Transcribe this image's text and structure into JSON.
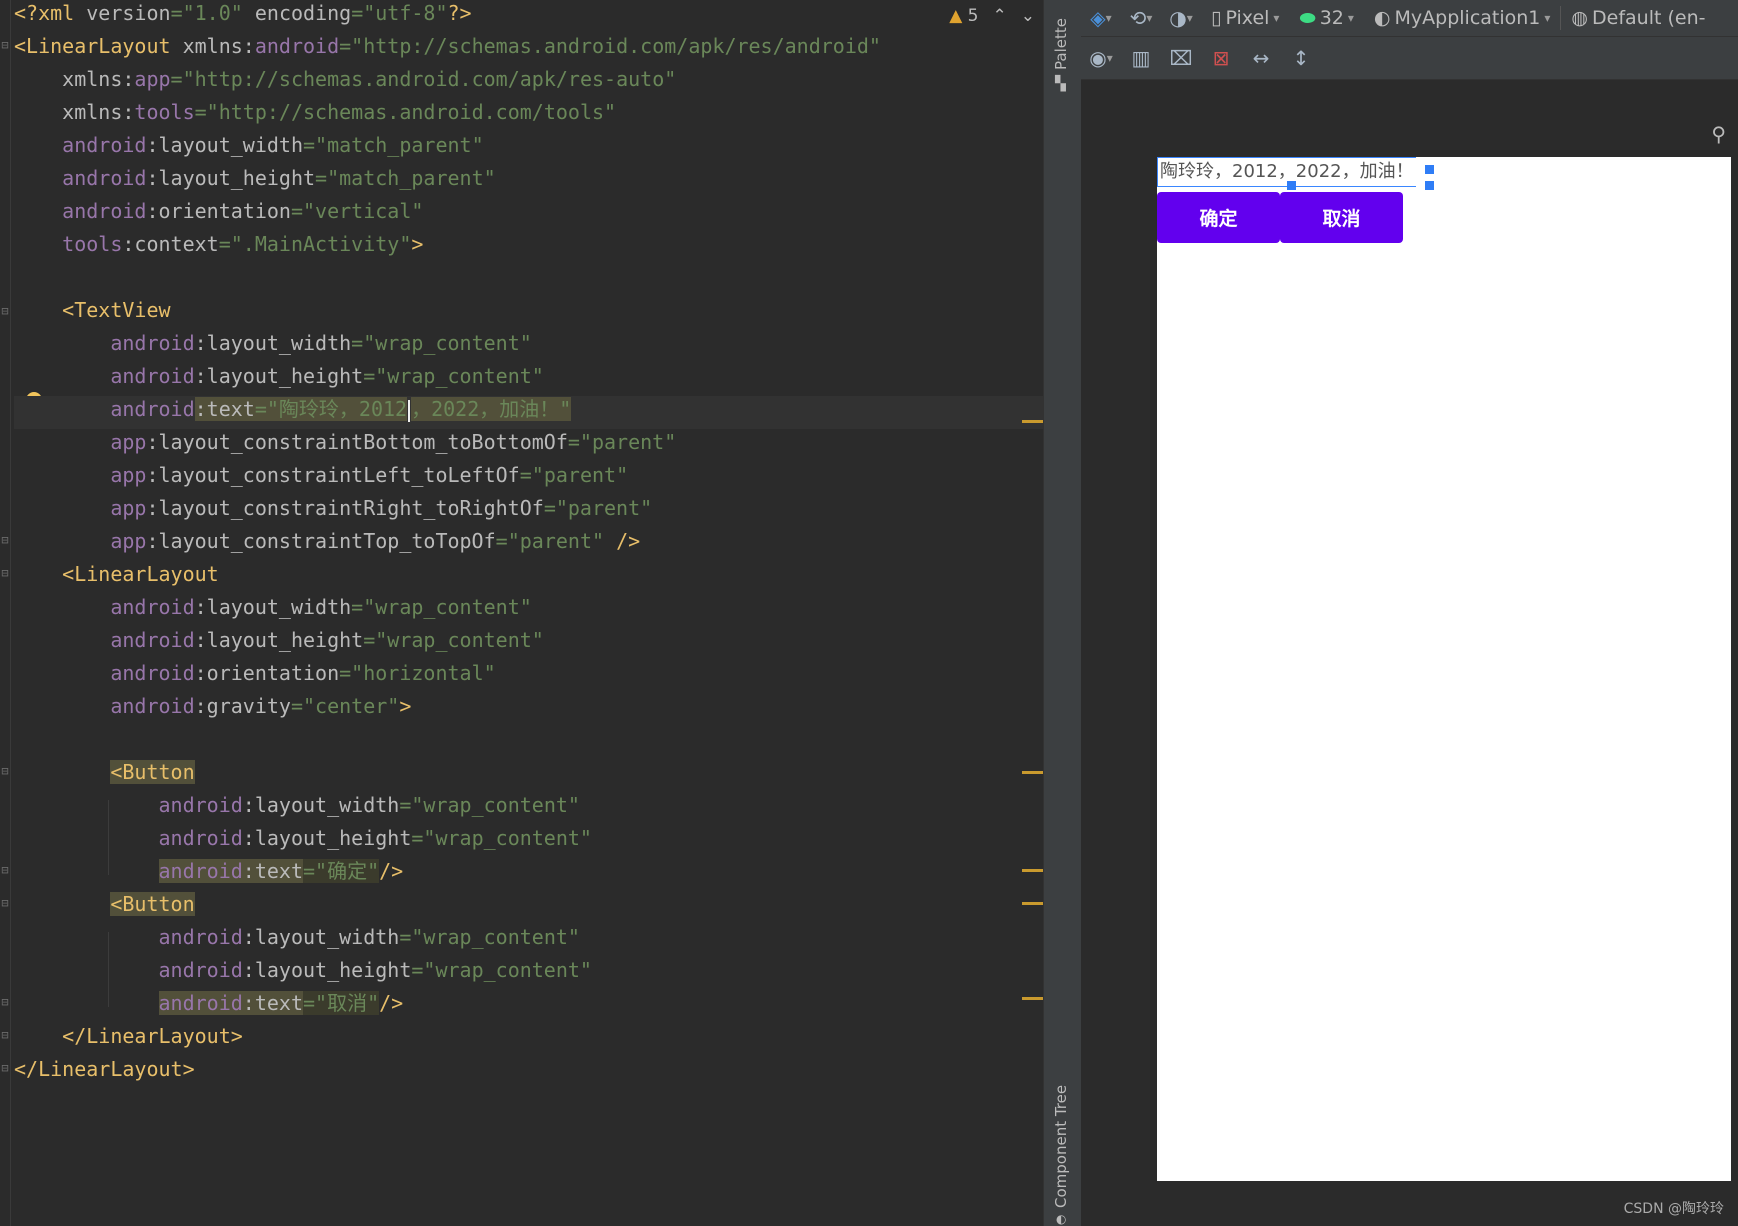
{
  "editor": {
    "warnings_count": "5",
    "lines": [
      [
        [
          "punc",
          "<?"
        ],
        [
          "tag",
          "xml "
        ],
        [
          "attr",
          "version"
        ],
        [
          "val",
          "=\"1.0\" "
        ],
        [
          "attr",
          "encoding"
        ],
        [
          "val",
          "=\"utf-8\""
        ],
        [
          "punc",
          "?>"
        ]
      ],
      [
        [
          "tag",
          "<LinearLayout "
        ],
        [
          "attr",
          "xmlns:"
        ],
        [
          "ns",
          "android"
        ],
        [
          "val",
          "=\"http://schemas.android.com/apk/res/android\""
        ]
      ],
      [
        [
          "attr",
          "    xmlns:"
        ],
        [
          "ns",
          "app"
        ],
        [
          "val",
          "=\"http://schemas.android.com/apk/res-auto\""
        ]
      ],
      [
        [
          "attr",
          "    xmlns:"
        ],
        [
          "ns",
          "tools"
        ],
        [
          "val",
          "=\"http://schemas.android.com/tools\""
        ]
      ],
      [
        [
          "ns",
          "    android"
        ],
        [
          "attr",
          ":layout_width"
        ],
        [
          "val",
          "=\"match_parent\""
        ]
      ],
      [
        [
          "ns",
          "    android"
        ],
        [
          "attr",
          ":layout_height"
        ],
        [
          "val",
          "=\"match_parent\""
        ]
      ],
      [
        [
          "ns",
          "    android"
        ],
        [
          "attr",
          ":orientation"
        ],
        [
          "val",
          "=\"vertical\""
        ]
      ],
      [
        [
          "ns",
          "    tools"
        ],
        [
          "attr",
          ":context"
        ],
        [
          "val",
          "=\".MainActivity\""
        ],
        [
          "tag",
          ">"
        ]
      ],
      [
        [
          "attr",
          ""
        ]
      ],
      [
        [
          "tag",
          "    <TextView"
        ]
      ],
      [
        [
          "ns",
          "        android"
        ],
        [
          "attr",
          ":layout_width"
        ],
        [
          "val",
          "=\"wrap_content\""
        ]
      ],
      [
        [
          "ns",
          "        android"
        ],
        [
          "attr",
          ":layout_height"
        ],
        [
          "val",
          "=\"wrap_content\""
        ]
      ],
      [
        [
          "ns",
          "        android"
        ],
        [
          "attr",
          ":text"
        ],
        [
          "val",
          "=\"陶玲玲，2012"
        ],
        [
          "caret",
          ""
        ],
        [
          "val",
          "，2022，加油！\""
        ]
      ],
      [
        [
          "ns",
          "        app"
        ],
        [
          "attr",
          ":layout_constraintBottom_toBottomOf"
        ],
        [
          "val",
          "=\"parent\""
        ]
      ],
      [
        [
          "ns",
          "        app"
        ],
        [
          "attr",
          ":layout_constraintLeft_toLeftOf"
        ],
        [
          "val",
          "=\"parent\""
        ]
      ],
      [
        [
          "ns",
          "        app"
        ],
        [
          "attr",
          ":layout_constraintRight_toRightOf"
        ],
        [
          "val",
          "=\"parent\""
        ]
      ],
      [
        [
          "ns",
          "        app"
        ],
        [
          "attr",
          ":layout_constraintTop_toTopOf"
        ],
        [
          "val",
          "=\"parent\" "
        ],
        [
          "tag",
          "/>"
        ]
      ],
      [
        [
          "tag",
          "    <LinearLayout"
        ]
      ],
      [
        [
          "ns",
          "        android"
        ],
        [
          "attr",
          ":layout_width"
        ],
        [
          "val",
          "=\"wrap_content\""
        ]
      ],
      [
        [
          "ns",
          "        android"
        ],
        [
          "attr",
          ":layout_height"
        ],
        [
          "val",
          "=\"wrap_content\""
        ]
      ],
      [
        [
          "ns",
          "        android"
        ],
        [
          "attr",
          ":orientation"
        ],
        [
          "val",
          "=\"horizontal\""
        ]
      ],
      [
        [
          "ns",
          "        android"
        ],
        [
          "attr",
          ":gravity"
        ],
        [
          "val",
          "=\"center\""
        ],
        [
          "tag",
          ">"
        ]
      ],
      [
        [
          "attr",
          ""
        ]
      ],
      [
        [
          "attr",
          "        "
        ],
        [
          "tagw",
          "<Button"
        ]
      ],
      [
        [
          "ns",
          "            android"
        ],
        [
          "attr",
          ":layout_width"
        ],
        [
          "val",
          "=\"wrap_content\""
        ]
      ],
      [
        [
          "ns",
          "            android"
        ],
        [
          "attr",
          ":layout_height"
        ],
        [
          "val",
          "=\"wrap_content\""
        ]
      ],
      [
        [
          "attr",
          "            "
        ],
        [
          "nsw",
          "android"
        ],
        [
          "attrw",
          ":text"
        ],
        [
          "valw",
          "=\"确定\""
        ],
        [
          "tag",
          "/>"
        ]
      ],
      [
        [
          "attr",
          "        "
        ],
        [
          "tagw",
          "<Button"
        ]
      ],
      [
        [
          "ns",
          "            android"
        ],
        [
          "attr",
          ":layout_width"
        ],
        [
          "val",
          "=\"wrap_content\""
        ]
      ],
      [
        [
          "ns",
          "            android"
        ],
        [
          "attr",
          ":layout_height"
        ],
        [
          "val",
          "=\"wrap_content\""
        ]
      ],
      [
        [
          "attr",
          "            "
        ],
        [
          "nsw",
          "android"
        ],
        [
          "attrw",
          ":text"
        ],
        [
          "valw",
          "=\"取消\""
        ],
        [
          "tag",
          "/>"
        ]
      ],
      [
        [
          "tag",
          "    </LinearLayout>"
        ]
      ],
      [
        [
          "tag",
          "</LinearLayout>"
        ]
      ]
    ]
  },
  "side_tabs": {
    "palette": "Palette",
    "component_tree": "Component Tree"
  },
  "toolbar": {
    "device": "Pixel",
    "api": "32",
    "app": "MyApplication1",
    "locale": "Default (en-"
  },
  "preview": {
    "textview_text": "陶玲玲，2012，2022，加油！",
    "button_ok": "确定",
    "button_cancel": "取消"
  },
  "watermark": "CSDN @陶玲玲",
  "colors": {
    "accent_button": "#6200ee",
    "selection": "#2f7df6"
  }
}
